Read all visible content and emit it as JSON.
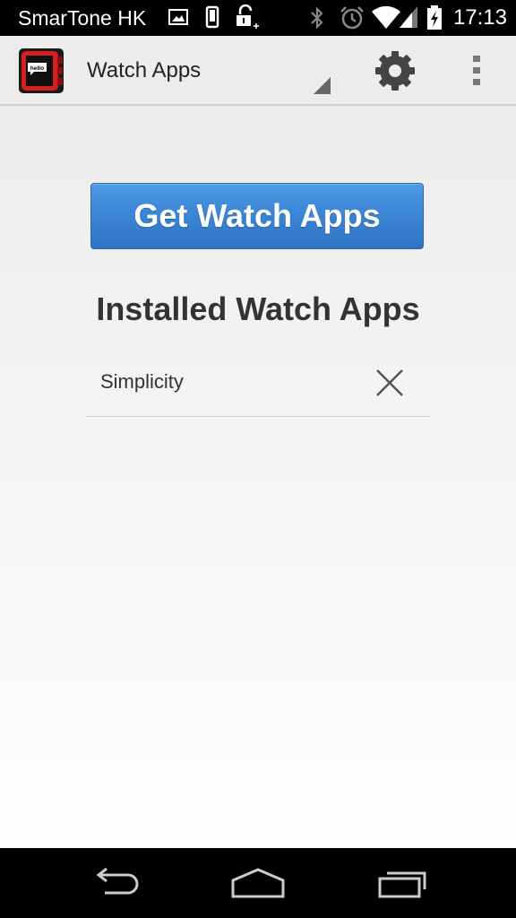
{
  "status_bar": {
    "carrier": "SmarTone HK",
    "time": "17:13",
    "icons": [
      "image-notification-icon",
      "phone-notification-icon",
      "unlock-notification-icon",
      "bluetooth-icon",
      "alarm-icon",
      "wifi-icon",
      "signal-icon",
      "battery-charging-icon"
    ]
  },
  "action_bar": {
    "title": "Watch Apps",
    "app_icon_text": "hello",
    "settings_icon": "gear-icon",
    "overflow_icon": "overflow-menu-icon"
  },
  "main": {
    "get_apps_label": "Get Watch Apps",
    "section_title": "Installed Watch Apps",
    "installed_apps": [
      {
        "name": "Simplicity",
        "remove_icon": "close-icon"
      }
    ]
  },
  "nav_bar": {
    "buttons": [
      "back-icon",
      "home-icon",
      "recent-apps-icon"
    ]
  },
  "colors": {
    "button_blue": "#3a84d4",
    "background": "#ededed",
    "app_icon_red": "#d42020"
  }
}
